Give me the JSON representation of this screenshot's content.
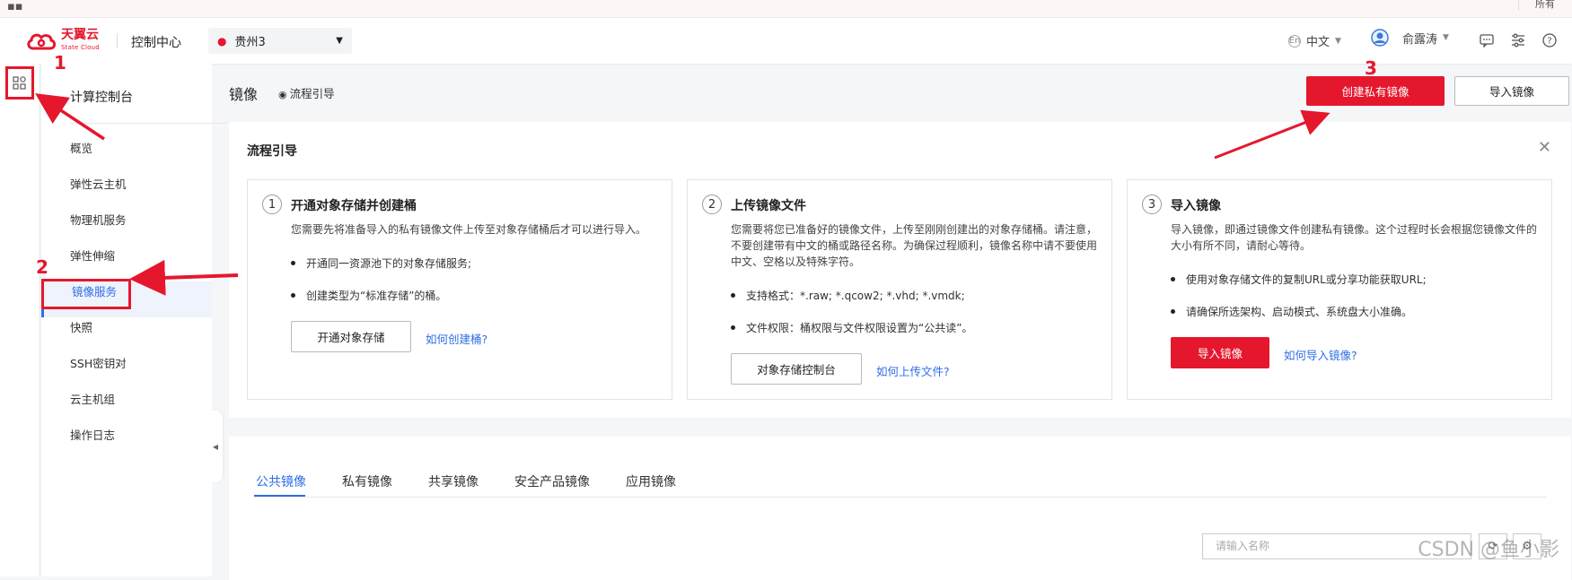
{
  "browser": {
    "right_label": "所有"
  },
  "header": {
    "brand_cn": "天翼云",
    "brand_en": "State Cloud",
    "console": "控制中心",
    "region": "贵州3",
    "lang": "中文",
    "user": "俞露涛"
  },
  "sidebar": {
    "title": "计算控制台",
    "items": [
      "概览",
      "弹性云主机",
      "物理机服务",
      "弹性伸缩",
      "镜像服务",
      "快照",
      "SSH密钥对",
      "云主机组",
      "操作日志"
    ]
  },
  "page": {
    "title": "镜像",
    "guide_link": "流程引导",
    "create_btn": "创建私有镜像",
    "import_btn": "导入镜像"
  },
  "guide": {
    "title": "流程引导",
    "steps": [
      {
        "num": "1",
        "title": "开通对象存储并创建桶",
        "desc": "您需要先将准备导入的私有镜像文件上传至对象存储桶后才可以进行导入。",
        "bullets": [
          "开通同一资源池下的对象存储服务;",
          "创建类型为“标准存储”的桶。"
        ],
        "button": "开通对象存储",
        "link": "如何创建桶?"
      },
      {
        "num": "2",
        "title": "上传镜像文件",
        "desc": "您需要将您已准备好的镜像文件，上传至刚刚创建出的对象存储桶。请注意，不要创建带有中文的桶或路径名称。为确保过程顺利，镜像名称中请不要使用中文、空格以及特殊字符。",
        "bullets": [
          "支持格式：*.raw; *.qcow2; *.vhd; *.vmdk;",
          "文件权限：桶权限与文件权限设置为“公共读”。"
        ],
        "button": "对象存储控制台",
        "link": "如何上传文件?"
      },
      {
        "num": "3",
        "title": "导入镜像",
        "desc": "导入镜像，即通过镜像文件创建私有镜像。这个过程时长会根据您镜像文件的大小有所不同，请耐心等待。",
        "bullets": [
          "使用对象存储文件的复制URL或分享功能获取URL;",
          "请确保所选架构、启动模式、系统盘大小准确。"
        ],
        "button": "导入镜像",
        "link": "如何导入镜像?"
      }
    ]
  },
  "tabs": [
    "公共镜像",
    "私有镜像",
    "共享镜像",
    "安全产品镜像",
    "应用镜像"
  ],
  "search": {
    "placeholder": "请输入名称"
  },
  "annotations": [
    "1",
    "2",
    "3"
  ],
  "watermark": "CSDN @鱼小影",
  "colors": {
    "accent": "#e5172d",
    "link": "#2f6ee6",
    "active_bg": "#eef3fc"
  }
}
